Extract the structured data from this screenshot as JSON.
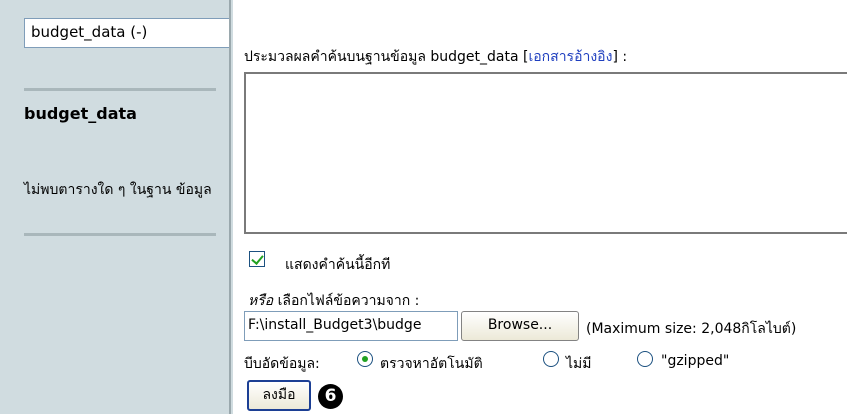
{
  "sidebar": {
    "database_select_value": "budget_data (-)",
    "database_name": "budget_data",
    "no_tables_message": "ไม่พบตารางใด ๆ ในฐาน ข้อมูล"
  },
  "query": {
    "heading_prefix": "ประมวลผลคำค้นบนฐานข้อมูล budget_data [",
    "heading_link": "เอกสารอ้างอิง",
    "heading_suffix": "] :",
    "textarea_value": ""
  },
  "show_again": {
    "checked": true,
    "label": "แสดงคำค้นนี้อีกที"
  },
  "file_import": {
    "heading_or": "หรือ",
    "heading_rest": " เลือกไฟล์ข้อความจาก :",
    "file_path_value": "F:\\install_Budget3\\budge",
    "browse_label": "Browse...",
    "max_size_note": "(Maximum size: 2,048กิโลไบต์)"
  },
  "compression": {
    "label": "บีบอัดข้อมูล:",
    "options": [
      {
        "label": "ตรวจหาอัตโนมัติ",
        "selected": true
      },
      {
        "label": "ไม่มี",
        "selected": false
      },
      {
        "label": "\"gzipped\"",
        "selected": false
      }
    ]
  },
  "actions": {
    "go_label": "ลงมือ",
    "step_marker": "6"
  },
  "colors": {
    "sidebar_bg": "#d0dce0",
    "link": "#1f3fbf",
    "check_mark": "#21a121"
  }
}
